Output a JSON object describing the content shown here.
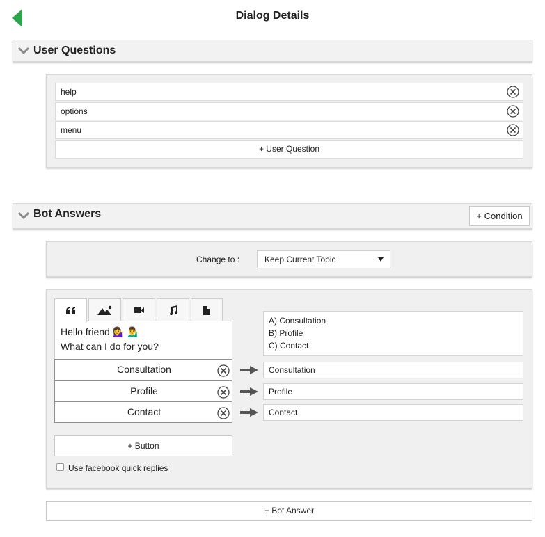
{
  "header": {
    "title": "Dialog Details"
  },
  "user_questions": {
    "title": "User Questions",
    "items": [
      {
        "text": "help"
      },
      {
        "text": "options"
      },
      {
        "text": "menu"
      }
    ],
    "add_label": "+ User Question"
  },
  "bot_answers": {
    "title": "Bot Answers",
    "condition_label": "+ Condition",
    "change_to_label": "Change to :",
    "change_to_value": "Keep Current Topic",
    "tabs": [
      {
        "icon": "quote-icon",
        "active": true
      },
      {
        "icon": "image-icon",
        "active": false
      },
      {
        "icon": "video-icon",
        "active": false
      },
      {
        "icon": "music-icon",
        "active": false
      },
      {
        "icon": "file-icon",
        "active": false
      }
    ],
    "message": {
      "line1": "Hello friend  💁‍♀️ 💁‍♂️",
      "line2": "What can I do for you?"
    },
    "buttons": [
      {
        "label": "Consultation",
        "target": "Consultation"
      },
      {
        "label": "Profile",
        "target": "Profile"
      },
      {
        "label": "Contact",
        "target": "Contact"
      }
    ],
    "options_text": [
      "A) Consultation",
      "B) Profile",
      "C) Contact"
    ],
    "add_button_label": "+ Button",
    "quick_replies_label": "Use facebook quick replies",
    "quick_replies_checked": false,
    "add_answer_label": "+ Bot Answer"
  },
  "colors": {
    "accent": "#2ea44f",
    "panel_bg": "#f0f0f0",
    "border": "#d8d8d8"
  }
}
